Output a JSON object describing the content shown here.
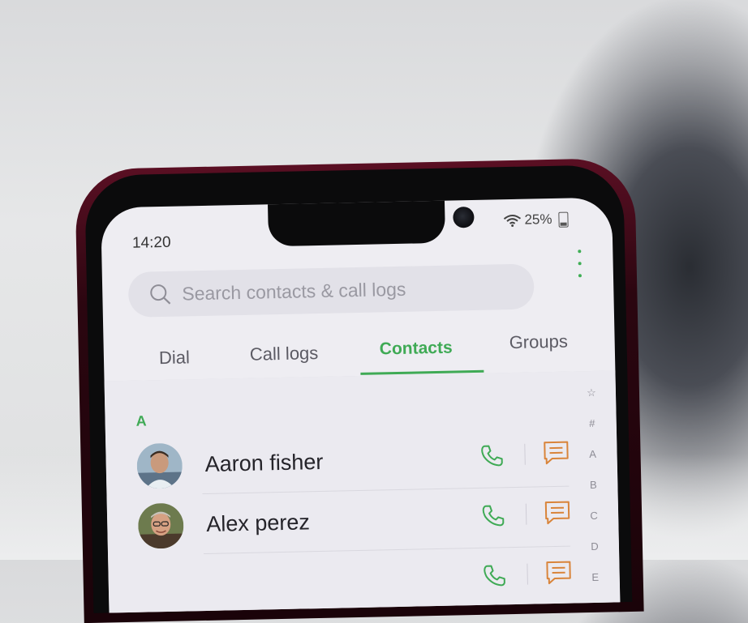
{
  "status_bar": {
    "time": "14:20",
    "battery": "25%"
  },
  "search": {
    "placeholder": "Search contacts & call logs"
  },
  "tabs": [
    {
      "label": "Dial"
    },
    {
      "label": "Call logs"
    },
    {
      "label": "Contacts",
      "active": true
    },
    {
      "label": "Groups"
    }
  ],
  "index_bar": [
    "☆",
    "#",
    "A",
    "B",
    "C",
    "D",
    "E"
  ],
  "section": {
    "letter": "A"
  },
  "contacts": [
    {
      "name": "Aaron fisher"
    },
    {
      "name": "Alex perez"
    }
  ],
  "colors": {
    "accent_green": "#3faa55",
    "message_orange": "#d9843a"
  }
}
